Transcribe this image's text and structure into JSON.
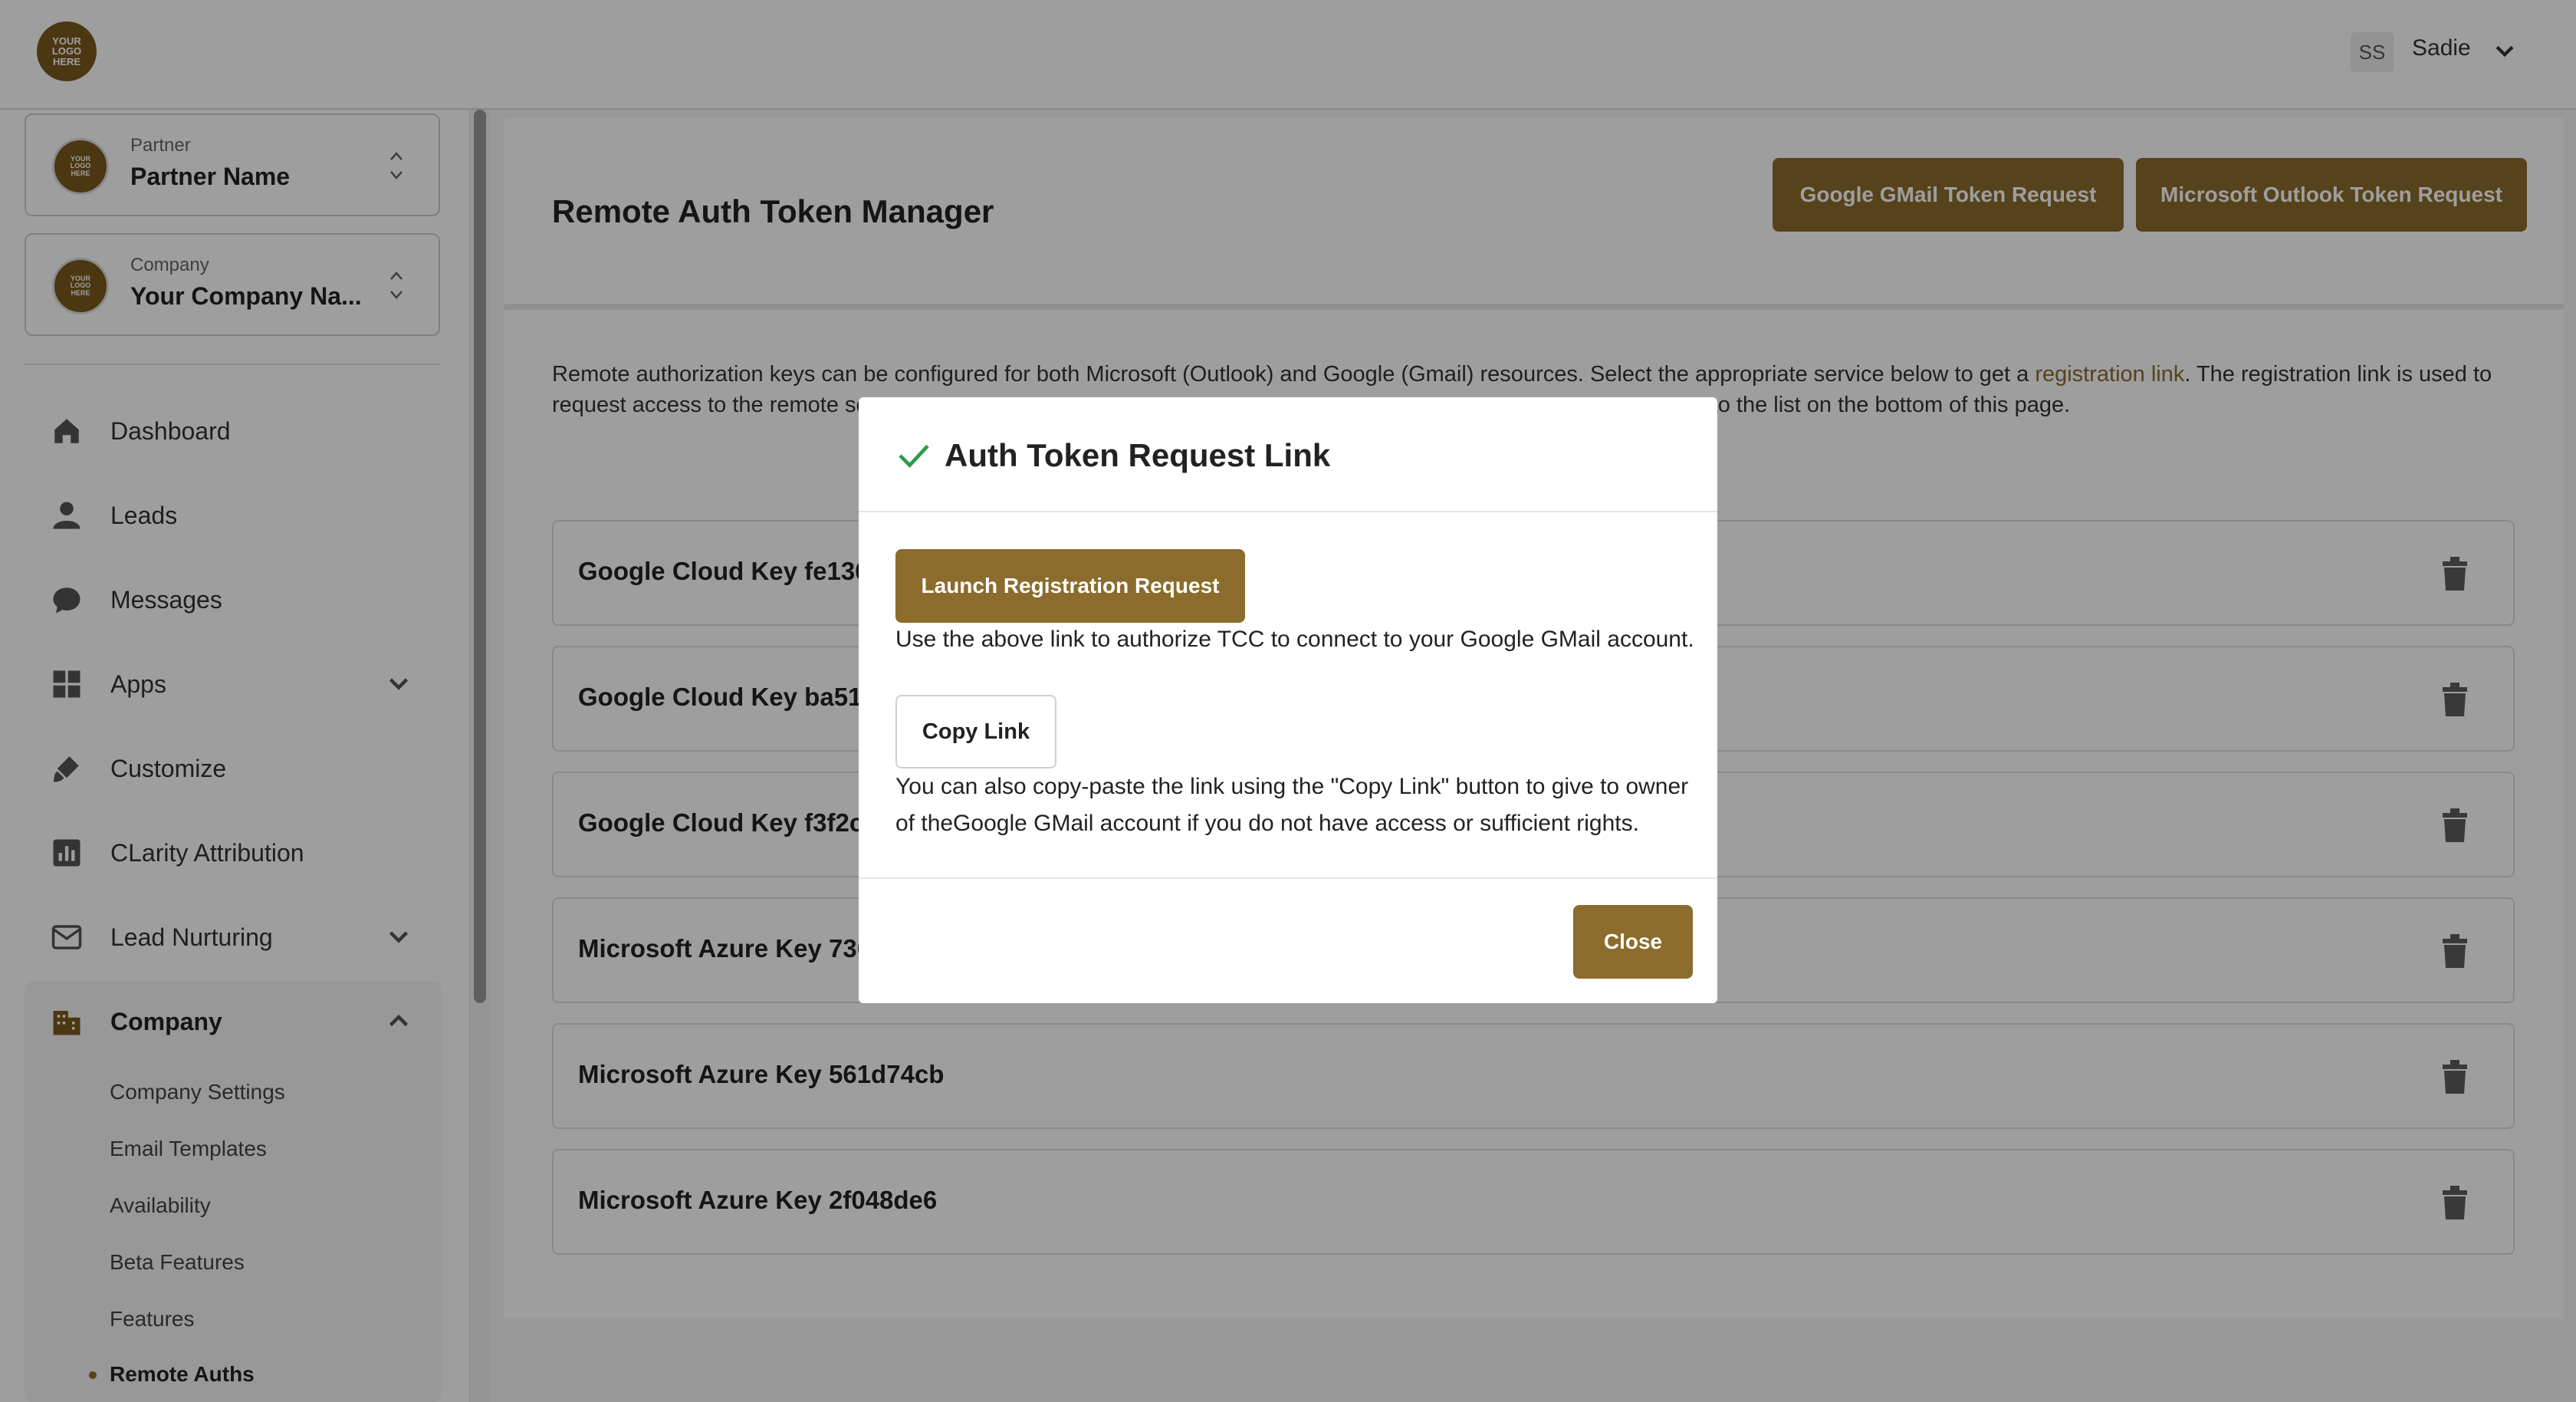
{
  "header": {
    "logo_text": "YOUR LOGO HERE",
    "user_initials": "SS",
    "user_name": "Sadie"
  },
  "sidebar": {
    "partner": {
      "small_label": "Partner",
      "name": "Partner Name"
    },
    "company": {
      "small_label": "Company",
      "name": "Your Company Na..."
    },
    "nav": [
      {
        "label": "Dashboard",
        "icon": "home-icon"
      },
      {
        "label": "Leads",
        "icon": "person-icon"
      },
      {
        "label": "Messages",
        "icon": "chat-icon"
      },
      {
        "label": "Apps",
        "icon": "apps-grid-icon"
      },
      {
        "label": "Customize",
        "icon": "brush-icon"
      },
      {
        "label": "CLarity Attribution",
        "icon": "bar-chart-icon"
      },
      {
        "label": "Lead Nurturing",
        "icon": "mail-icon"
      },
      {
        "label": "Company",
        "icon": "building-icon"
      }
    ],
    "company_sub": [
      "Company Settings",
      "Email Templates",
      "Availability",
      "Beta Features",
      "Features",
      "Remote Auths"
    ]
  },
  "main": {
    "title": "Remote Auth Token Manager",
    "buttons": {
      "gmail": "Google GMail Token Request",
      "outlook": "Microsoft Outlook Token Request"
    },
    "description_part1": "Remote authorization keys can be configured for both Microsoft (Outlook) and Google (Gmail) resources. Select the appropriate service below to get a ",
    "description_link": "registration link",
    "description_part2": ". The registration link is used to request access to the remote se",
    "description_part3": "to the list on the bottom of this page.",
    "keys": [
      "Google Cloud Key fe1365",
      "Google Cloud Key ba51b",
      "Google Cloud Key f3f2c7",
      "Microsoft Azure Key 7361",
      "Microsoft Azure Key 561d74cb",
      "Microsoft Azure Key 2f048de6"
    ]
  },
  "modal": {
    "title": "Auth Token Request Link",
    "launch_button": "Launch Registration Request",
    "launch_help": "Use the above link to authorize TCC to connect to your Google GMail account.",
    "copy_button": "Copy Link",
    "copy_help_line1": "You can also copy-paste the link using the \"Copy Link\" button to give to owner",
    "copy_help_line2": "of theGoogle GMail account if you do not have access or sufficient rights.",
    "close_button": "Close"
  },
  "colors": {
    "accent": "#8b6c2c",
    "success": "#2e9b46"
  }
}
